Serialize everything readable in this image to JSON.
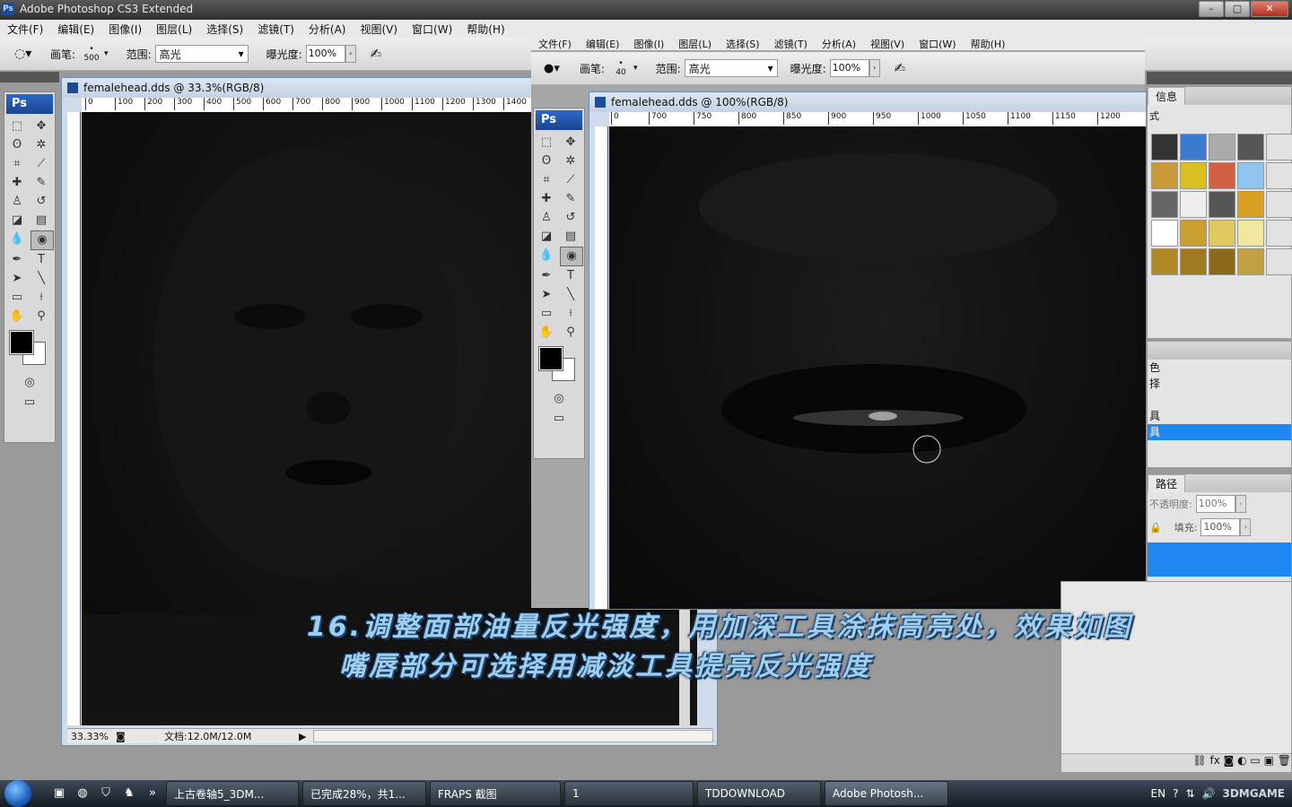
{
  "app": {
    "title": "Adobe Photoshop CS3 Extended",
    "ps_badge": "Ps",
    "win_buttons": [
      "–",
      "▢",
      "✕"
    ]
  },
  "menu_main": [
    "文件(F)",
    "编辑(E)",
    "图像(I)",
    "图层(L)",
    "选择(S)",
    "滤镜(T)",
    "分析(A)",
    "视图(V)",
    "窗口(W)",
    "帮助(H)"
  ],
  "menu_second": [
    "文件(F)",
    "编辑(E)",
    "图像(I)",
    "图层(L)",
    "选择(S)",
    "滤镜(T)",
    "分析(A)",
    "视图(V)",
    "窗口(W)",
    "帮助(H)"
  ],
  "options_left": {
    "brush_label": "画笔:",
    "brush_size": "500",
    "range_label": "范围:",
    "range_value": "高光",
    "exposure_label": "曝光度:",
    "exposure_value": "100%"
  },
  "options_right": {
    "brush_label": "画笔:",
    "brush_size": "40",
    "range_label": "范围:",
    "range_value": "高光",
    "exposure_label": "曝光度:",
    "exposure_value": "100%"
  },
  "toolbox": {
    "logo": "Ps",
    "type_tool": "T"
  },
  "doc_left": {
    "title": "femalehead.dds @ 33.3%(RGB/8)",
    "ruler": [
      "0",
      "100",
      "200",
      "300",
      "400",
      "500",
      "600",
      "700",
      "800",
      "900",
      "1000",
      "1100",
      "1200",
      "1300",
      "1400"
    ],
    "zoom": "33.33%",
    "doc_size": "文档:12.0M/12.0M"
  },
  "doc_right": {
    "title": "femalehead.dds @ 100%(RGB/8)",
    "ruler": [
      "0",
      "700",
      "750",
      "800",
      "850",
      "900",
      "950",
      "1000",
      "1050",
      "1100",
      "1150",
      "1200"
    ]
  },
  "panels": {
    "top_tab": "信息",
    "styles_tab": "式",
    "list_items": [
      "色",
      "择",
      "具",
      "具"
    ],
    "paths_tab": "路径",
    "opacity_label": "不透明度:",
    "opacity_value": "100%",
    "fill_label": "填充:",
    "fill_value": "100%"
  },
  "caption": {
    "line1": "16.调整面部油量反光强度，用加深工具涂抹高亮处，效果如图",
    "line2": "嘴唇部分可选择用减淡工具提亮反光强度"
  },
  "taskbar": {
    "buttons": [
      "上古卷轴5_3DM...",
      "已完成28%，共1...",
      "FRAPS 截图",
      "1",
      "TDDOWNLOAD",
      "Adobe Photosh..."
    ],
    "lang": "EN",
    "watermark": "3DMGAME"
  },
  "colors": {
    "accent": "#1a4c9a",
    "caption": "#9ecff0",
    "selection": "#1e88f0"
  }
}
